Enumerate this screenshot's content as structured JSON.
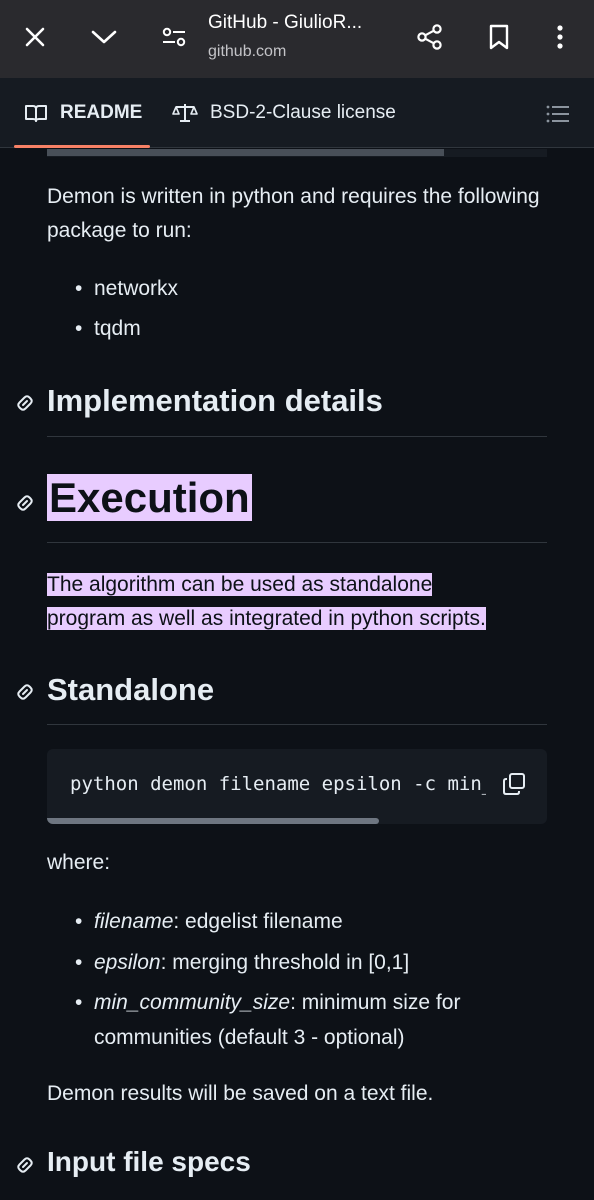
{
  "browser": {
    "title": "GitHub - GiulioR...",
    "url": "github.com",
    "icons": [
      "close-icon",
      "chevron-down-icon",
      "page-settings-icon",
      "share-icon",
      "bookmark-icon",
      "more-icon"
    ]
  },
  "tabs": {
    "readme": "README",
    "license": "BSD-2-Clause license"
  },
  "content": {
    "intro": "Demon is written in python and requires the following package to run:",
    "packages": [
      "networkx",
      "tqdm"
    ],
    "h_impl": "Implementation details",
    "h_exec": "Execution",
    "exec_line1": "The algorithm can be used as standalone",
    "exec_line2": "program as well as integrated in python scripts.",
    "h_standalone": "Standalone",
    "code": "python demon filename epsilon -c min_community_size",
    "where": "where:",
    "params": [
      {
        "name": "filename",
        "desc": ": edgelist filename"
      },
      {
        "name": "epsilon",
        "desc": ": merging threshold in [0,1]"
      },
      {
        "name": "min_community_size",
        "desc": ": minimum size for communities (default 3 - optional)"
      }
    ],
    "results": "Demon results will be saved on a text file.",
    "h_input": "Input file specs"
  },
  "colors": {
    "background": "#0d1117",
    "highlight": "#e8ccff",
    "tab_underline": "#f78166"
  }
}
